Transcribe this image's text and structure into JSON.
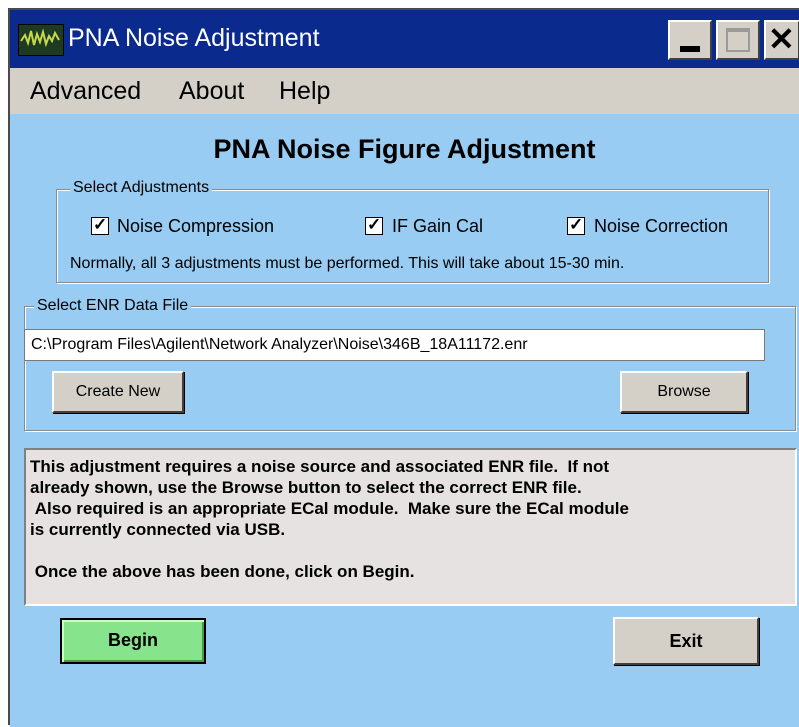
{
  "window": {
    "title": "PNA Noise Adjustment"
  },
  "menu": [
    {
      "label": "Advanced"
    },
    {
      "label": "About"
    },
    {
      "label": "Help"
    }
  ],
  "heading": "PNA Noise Figure Adjustment",
  "adjustments": {
    "legend": "Select Adjustments",
    "options": [
      {
        "label": "Noise Compression",
        "checked": true
      },
      {
        "label": "IF Gain Cal",
        "checked": true
      },
      {
        "label": "Noise Correction",
        "checked": true
      }
    ],
    "note": "Normally, all 3 adjustments must be performed.  This will take about 15-30 min."
  },
  "enr": {
    "legend": "Select ENR Data File",
    "path": "C:\\Program Files\\Agilent\\Network Analyzer\\Noise\\346B_18A11172.enr",
    "create_new_label": "Create New",
    "browse_label": "Browse"
  },
  "info_text": "This adjustment requires a noise source and associated ENR file.  If not\nalready shown, use the Browse button to select the correct ENR file.\n Also required is an appropriate ECal module.  Make sure the ECal module\nis currently connected via USB.\n\n Once the above has been done, click on Begin.",
  "buttons": {
    "begin_label": "Begin",
    "exit_label": "Exit"
  },
  "colors": {
    "titlebar": "#0a2a8e",
    "client": "#99ccf2",
    "begin": "#88e48c"
  },
  "icons": [
    "app-logo-icon",
    "minimize-icon",
    "maximize-icon",
    "close-icon",
    "checkmark-icon"
  ]
}
